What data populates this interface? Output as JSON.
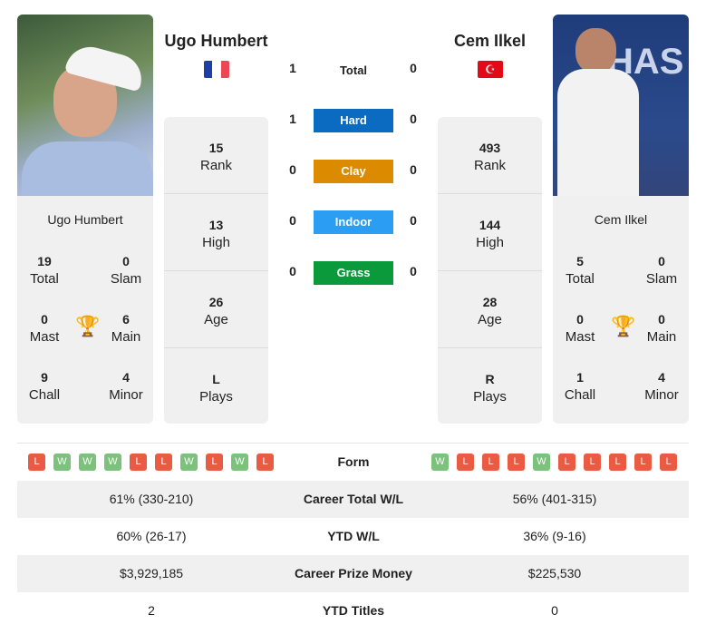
{
  "colors": {
    "win": "#7cc17c",
    "loss": "#ea5b44",
    "hard": "#0a6bc1",
    "clay": "#dc8a00",
    "indoor": "#2b9ef3",
    "grass": "#0a9a3c",
    "card": "#f0f0f0"
  },
  "player1": {
    "name": "Ugo Humbert",
    "flag": "France",
    "card_name": "Ugo Humbert",
    "titles": {
      "total": "19",
      "slam": "0",
      "mast": "0",
      "main": "6",
      "chall": "9",
      "minor": "4"
    },
    "rank": "15",
    "high": "13",
    "age": "26",
    "plays": "L",
    "form": [
      "L",
      "W",
      "W",
      "W",
      "L",
      "L",
      "W",
      "L",
      "W",
      "L"
    ]
  },
  "player2": {
    "name": "Cem Ilkel",
    "flag": "Turkey",
    "card_name": "Cem Ilkel",
    "titles": {
      "total": "5",
      "slam": "0",
      "mast": "0",
      "main": "0",
      "chall": "1",
      "minor": "4"
    },
    "rank": "493",
    "high": "144",
    "age": "28",
    "plays": "R",
    "form": [
      "W",
      "L",
      "L",
      "L",
      "W",
      "L",
      "L",
      "L",
      "L",
      "L"
    ]
  },
  "labels": {
    "total": "Total",
    "slam": "Slam",
    "mast": "Mast",
    "main": "Main",
    "chall": "Chall",
    "minor": "Minor",
    "rank": "Rank",
    "high": "High",
    "age": "Age",
    "plays": "Plays",
    "form": "Form"
  },
  "h2h": [
    {
      "label": "Total",
      "p1": "1",
      "p2": "0"
    },
    {
      "label": "Hard",
      "p1": "1",
      "p2": "0"
    },
    {
      "label": "Clay",
      "p1": "0",
      "p2": "0"
    },
    {
      "label": "Indoor",
      "p1": "0",
      "p2": "0"
    },
    {
      "label": "Grass",
      "p1": "0",
      "p2": "0"
    }
  ],
  "comparison": [
    {
      "label": "Career Total W/L",
      "p1": "61% (330-210)",
      "p2": "56% (401-315)"
    },
    {
      "label": "YTD W/L",
      "p1": "60% (26-17)",
      "p2": "36% (9-16)"
    },
    {
      "label": "Career Prize Money",
      "p1": "$3,929,185",
      "p2": "$225,530"
    },
    {
      "label": "YTD Titles",
      "p1": "2",
      "p2": "0"
    }
  ],
  "icons": {
    "trophy": "trophy-icon"
  }
}
